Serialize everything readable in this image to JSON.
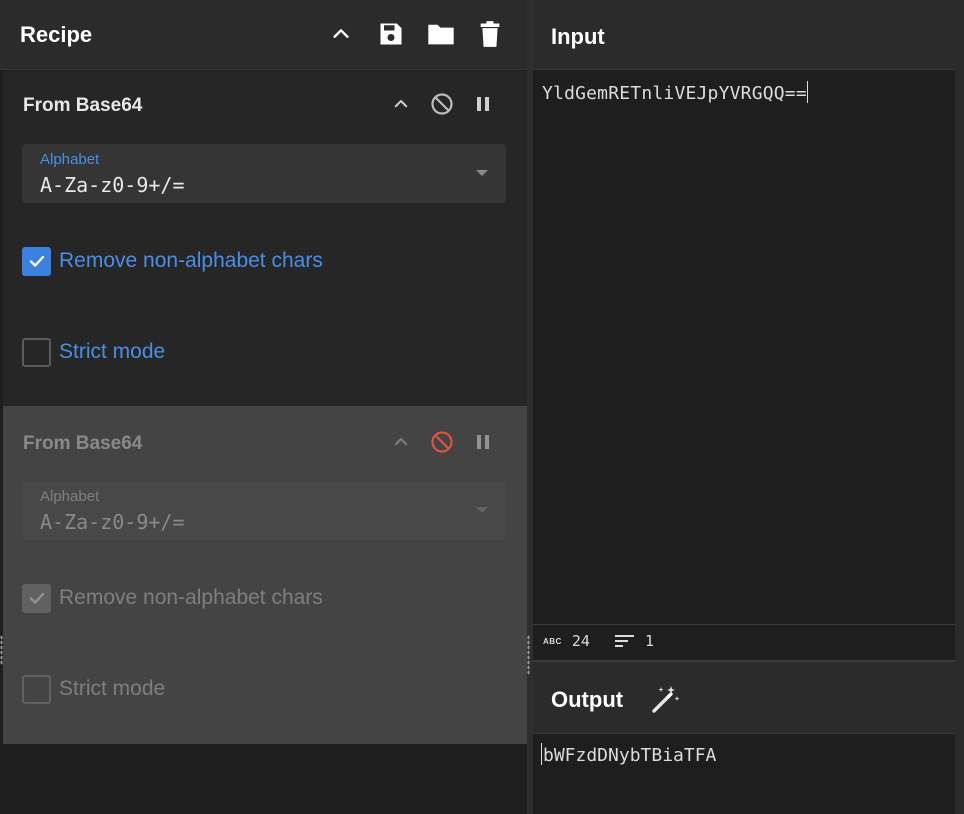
{
  "recipe": {
    "title": "Recipe",
    "operations": [
      {
        "name": "From Base64",
        "alphabet_label": "Alphabet",
        "alphabet_value": "A-Za-z0-9+/=",
        "remove_nonalpha_label": "Remove non-alphabet chars",
        "remove_nonalpha_checked": true,
        "strict_mode_label": "Strict mode",
        "strict_mode_checked": false,
        "disabled": false
      },
      {
        "name": "From Base64",
        "alphabet_label": "Alphabet",
        "alphabet_value": "A-Za-z0-9+/=",
        "remove_nonalpha_label": "Remove non-alphabet chars",
        "remove_nonalpha_checked": true,
        "strict_mode_label": "Strict mode",
        "strict_mode_checked": false,
        "disabled": true
      }
    ]
  },
  "input": {
    "title": "Input",
    "text": "YldGemRETnliVEJpYVRGQQ==",
    "stats": {
      "length": "24",
      "lines": "1"
    }
  },
  "output": {
    "title": "Output",
    "text": "bWFzdDNybTBiaTFA"
  },
  "colors": {
    "accent": "#4a8fe6",
    "disabled_icon": "#e0533f",
    "background": "#1e1e1e",
    "header": "#2b2b2b"
  },
  "icons": {
    "collapse": "chevron-up-icon",
    "save": "save-icon",
    "open": "folder-icon",
    "clear": "trash-icon",
    "disable": "disable-icon",
    "breakpoint": "pause-icon",
    "magic": "magic-wand-icon"
  }
}
